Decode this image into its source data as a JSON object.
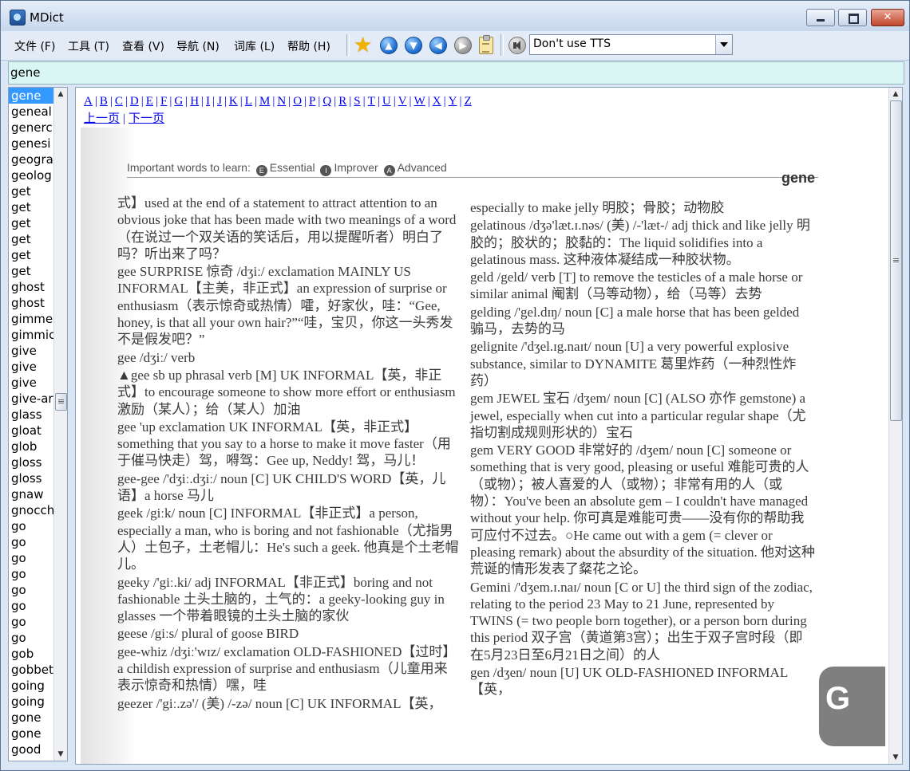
{
  "window": {
    "title": "MDict"
  },
  "menu": [
    "文件 (F)",
    "工具 (T)",
    "查看 (V)",
    "导航 (N)",
    "词库 (L)",
    "帮助 (H)"
  ],
  "toolbar": {
    "icons": [
      "star-icon",
      "arrow-up-icon",
      "arrow-down-icon",
      "arrow-left-icon",
      "arrow-right-icon",
      "clipboard-icon",
      "speaker-icon"
    ],
    "tts_selected": "Don't use TTS"
  },
  "search": {
    "value": "gene"
  },
  "wordlist": {
    "items": [
      "gene",
      "geneal",
      "generc",
      "genesi",
      "geogra",
      "geolog",
      "get",
      "get",
      "get",
      "get",
      "get",
      "get",
      "ghost",
      "ghost",
      "gimme",
      "gimmic",
      "give",
      "give",
      "give",
      "give-ar",
      "glass",
      "gloat",
      "glob",
      "gloss",
      "gloss",
      "gnaw",
      "gnocch",
      "go",
      "go",
      "go",
      "go",
      "go",
      "go",
      "go",
      "go",
      "gob",
      "gobbet",
      "going",
      "going",
      "gone",
      "gone",
      "good"
    ]
  },
  "nav": {
    "letters": [
      "A",
      "B",
      "C",
      "D",
      "E",
      "F",
      "G",
      "H",
      "I",
      "J",
      "K",
      "L",
      "M",
      "N",
      "O",
      "P",
      "Q",
      "R",
      "S",
      "T",
      "U",
      "V",
      "W",
      "X",
      "Y",
      "Z"
    ],
    "prev": "上一页",
    "next": "下一页"
  },
  "page": {
    "header_prefix": "Important words to learn:",
    "header_e": "E",
    "essential": "Essential",
    "header_i": "I",
    "improver": "Improver",
    "header_a": "A",
    "advanced": "Advanced",
    "running_head": "gene",
    "thumb_letter": "G",
    "left": [
      "式】used at the end of a statement to attract attention to an obvious joke that has been made with two meanings of a word（在说过一个双关语的笑话后，用以提醒听者）明白了吗？听出来了吗？",
      "gee SURPRISE 惊奇 /dʒiː/ exclamation MAINLY US INFORMAL【主美，非正式】an expression of surprise or enthusiasm（表示惊奇或热情）嚯，好家伙，哇：“Gee, honey, is that all your own hair?”“哇，宝贝，你这一头秀发不是假发吧？”",
      "gee /dʒiː/ verb",
      "▲gee sb up phrasal verb [M] UK INFORMAL【英，非正式】to encourage someone to show more effort or enthusiasm 激励（某人）；给（某人）加油",
      "gee 'up exclamation UK INFORMAL【英，非正式】something that you say to a horse to make it move faster（用于催马快走）驾，嘚驾：Gee up, Neddy! 驾，马儿！",
      "gee-gee /'dʒiː.dʒiː/ noun [C] UK CHILD'S WORD【英，儿语】a horse 马儿",
      "geek /giːk/ noun [C] INFORMAL【非正式】a person, especially a man, who is boring and not fashionable（尤指男人）土包子，土老帽儿：He's such a geek. 他真是个土老帽儿。",
      "geeky /'giː.ki/ adj INFORMAL【非正式】boring and not fashionable 土头土脑的，土气的：a geeky-looking guy in glasses 一个带着眼镜的土头土脑的家伙",
      "geese /giːs/ plural of goose BIRD",
      "gee-whiz /dʒiː'wɪz/ exclamation OLD-FASHIONED【过时】a childish expression of surprise and enthusiasm（儿童用来表示惊奇和热情）嘿，哇",
      "geezer /'giː.zə'/ (美) /-zə/ noun [C] UK INFORMAL【英，"
    ],
    "right": [
      "especially to make jelly 明胶；骨胶；动物胶",
      "gelatinous /dʒə'læt.ɪ.nəs/ (美) /-'læt-/ adj thick and like jelly 明胶的；胶状的；胶黏的：The liquid solidifies into a gelatinous mass. 这种液体凝结成一种胶状物。",
      "geld /geld/ verb [T] to remove the testicles of a male horse or similar animal 阉割（马等动物），给（马等）去势",
      "gelding /'gel.dɪŋ/ noun [C] a male horse that has been gelded 骟马，去势的马",
      "gelignite /'dʒel.ɪg.naɪt/ noun [U] a very powerful explosive substance, similar to DYNAMITE 葛里炸药（一种烈性炸药）",
      "gem JEWEL 宝石 /dʒem/ noun [C] (ALSO 亦作 gemstone) a jewel, especially when cut into a particular regular shape（尤指切割成规则形状的）宝石",
      "gem VERY GOOD 非常好的 /dʒem/ noun [C] someone or something that is very good, pleasing or useful 难能可贵的人（或物）；被人喜爱的人（或物）；非常有用的人（或物）：You've been an absolute gem – I couldn't have managed without your help. 你可真是难能可贵——没有你的帮助我可应付不过去。○He came out with a gem (= clever or pleasing remark) about the absurdity of the situation. 他对这种荒诞的情形发表了粲花之论。",
      "Gemini /'dʒem.ɪ.naɪ/ noun [C or U] the third sign of the zodiac, relating to the period 23 May to 21 June, represented by TWINS (= two people born together), or a person born during this period 双子宫（黄道第3宫）；出生于双子宫时段（即在5月23日至6月21日之间）的人",
      "gen /dʒen/ noun [U] UK OLD-FASHIONED INFORMAL【英，"
    ]
  }
}
